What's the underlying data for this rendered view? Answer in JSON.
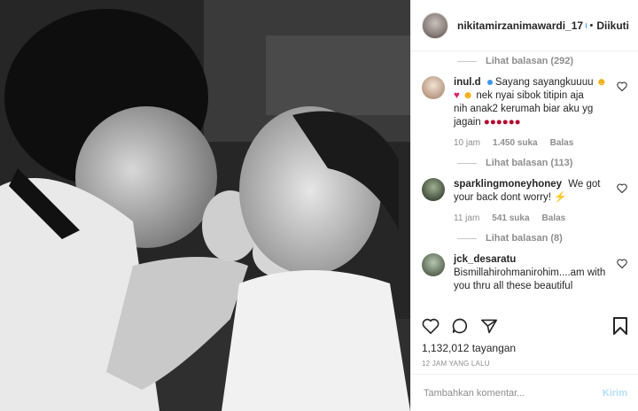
{
  "header": {
    "username": "nikitamirzanimawardi_17",
    "separator": "•",
    "follow_label": "Diikuti"
  },
  "thread": {
    "replies_1": "Lihat balasan (292)",
    "comment_1": {
      "user": "inul.d",
      "text_line1": "Sayang sayangkuuuu",
      "text_line2": "nek nyai sibok titipin aja",
      "text_line3": "nih anak2 kerumah biar aku yg",
      "text_line4": "jagain",
      "time": "10 jam",
      "likes": "1.450 suka",
      "reply": "Balas"
    },
    "replies_2": "Lihat balasan (113)",
    "comment_2": {
      "user": "sparklingmoneyhoney",
      "text": "We got your back dont worry!",
      "time": "11 jam",
      "likes": "541 suka",
      "reply": "Balas"
    },
    "replies_3": "Lihat balasan (8)",
    "comment_3": {
      "user": "jck_desaratu",
      "text_line1": "Bismillahirohmanirohim....am with",
      "text_line2": "you thru all these beautiful"
    }
  },
  "stats": {
    "views": "1,132,012 tayangan",
    "posted": "12 JAM YANG LALU"
  },
  "composer": {
    "placeholder": "Tambahkan komentar...",
    "send_label": "Kirim"
  }
}
